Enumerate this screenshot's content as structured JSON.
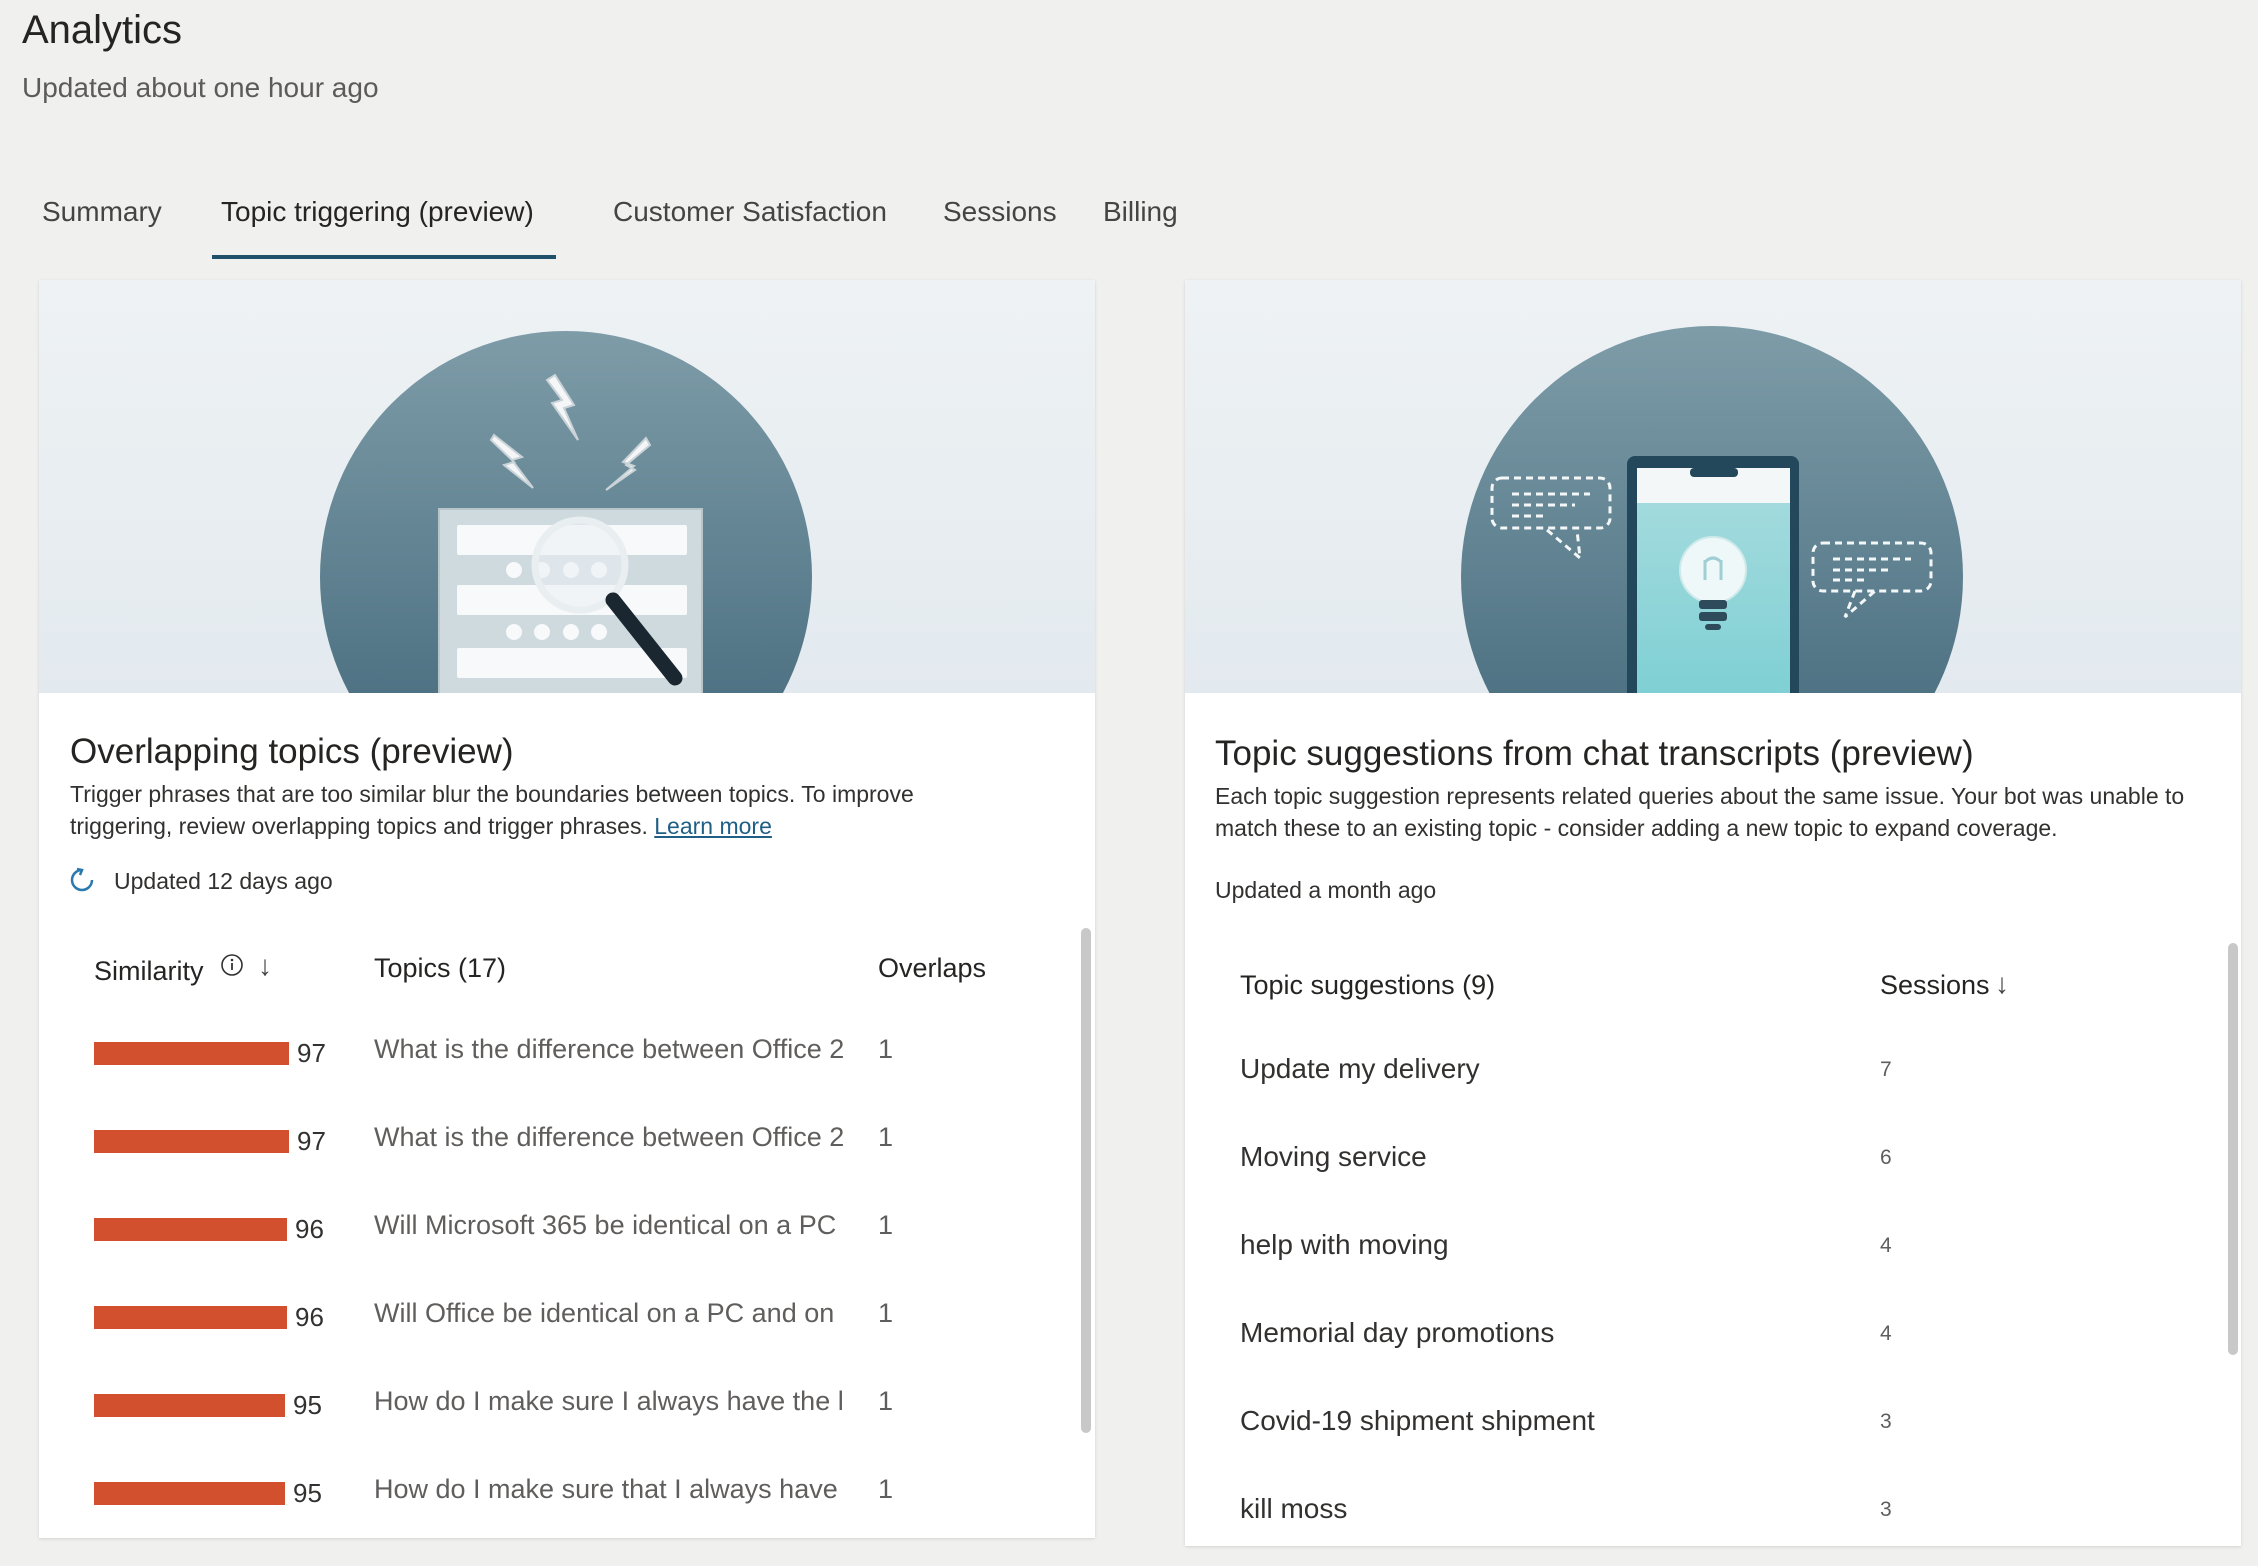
{
  "header": {
    "title": "Analytics",
    "subtitle": "Updated about one hour ago"
  },
  "tabs": [
    {
      "label": "Summary",
      "active": false
    },
    {
      "label": "Topic triggering (preview)",
      "active": true
    },
    {
      "label": "Customer Satisfaction",
      "active": false
    },
    {
      "label": "Sessions",
      "active": false
    },
    {
      "label": "Billing",
      "active": false
    }
  ],
  "overlapping": {
    "title": "Overlapping topics (preview)",
    "description": "Trigger phrases that are too similar blur the boundaries between topics. To improve triggering, review overlapping topics and trigger phrases.",
    "learn_more": "Learn more",
    "updated": "Updated 12 days ago",
    "columns": {
      "similarity": "Similarity",
      "topics": "Topics (17)",
      "overlaps": "Overlaps"
    },
    "rows": [
      {
        "score": "97",
        "topic": "What is the difference between Office 2",
        "overlaps": "1"
      },
      {
        "score": "97",
        "topic": "What is the difference between Office 2",
        "overlaps": "1"
      },
      {
        "score": "96",
        "topic": "Will Microsoft 365 be identical on a PC",
        "overlaps": "1"
      },
      {
        "score": "96",
        "topic": "Will Office be identical on a PC and on",
        "overlaps": "1"
      },
      {
        "score": "95",
        "topic": "How do I make sure I always have the l",
        "overlaps": "1"
      },
      {
        "score": "95",
        "topic": "How do I make sure that I always have",
        "overlaps": "1"
      }
    ]
  },
  "suggestions": {
    "title": "Topic suggestions from chat transcripts (preview)",
    "description": "Each topic suggestion represents related queries about the same issue. Your bot was unable to match these to an existing topic - consider adding a new topic to expand coverage.",
    "updated": "Updated a month ago",
    "columns": {
      "topic": "Topic suggestions (9)",
      "sessions": "Sessions"
    },
    "rows": [
      {
        "topic": "Update my delivery",
        "sessions": "7"
      },
      {
        "topic": "Moving service",
        "sessions": "6"
      },
      {
        "topic": "help with moving",
        "sessions": "4"
      },
      {
        "topic": "Memorial day promotions",
        "sessions": "4"
      },
      {
        "topic": "Covid-19 shipment shipment",
        "sessions": "3"
      },
      {
        "topic": "kill moss",
        "sessions": "3"
      }
    ]
  },
  "colors": {
    "accent": "#1f4f6a",
    "bar": "#d2502d",
    "link": "#1f5f86"
  },
  "icons": [
    "refresh-icon",
    "info-icon",
    "sort-arrow-down-icon",
    "lightning-icon",
    "magnifier-icon",
    "lightbulb-icon",
    "chat-bubble-icon"
  ]
}
